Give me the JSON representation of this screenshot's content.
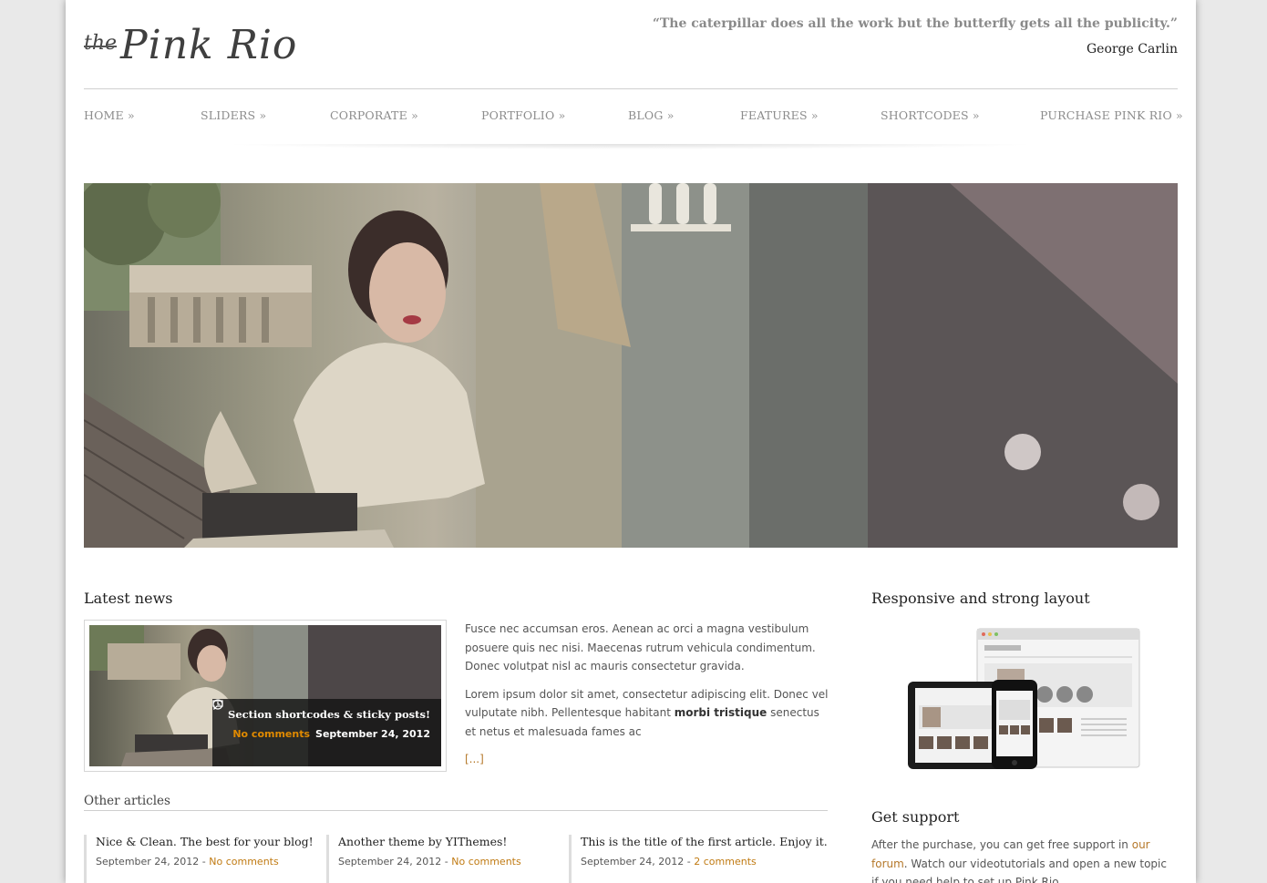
{
  "header": {
    "logo_the": "the",
    "logo_main": "Pink Rio",
    "quote": "“The caterpillar does all the work but the butterfly gets all the publicity.”",
    "quote_author": "George Carlin"
  },
  "nav": {
    "items": [
      {
        "label": "HOME »"
      },
      {
        "label": "SLIDERS »"
      },
      {
        "label": "CORPORATE »"
      },
      {
        "label": "PORTFOLIO »"
      },
      {
        "label": "BLOG »"
      },
      {
        "label": "FEATURES »"
      },
      {
        "label": "SHORTCODES »"
      },
      {
        "label": "PURCHASE PINK RIO »"
      }
    ]
  },
  "latest_news": {
    "heading": "Latest news",
    "caption_title": "Section shortcodes & sticky posts!",
    "caption_comments": "No comments",
    "caption_date": "September 24, 2012",
    "paragraph1": "Fusce nec accumsan eros. Aenean ac orci a magna vestibulum posuere quis nec nisi. Maecenas rutrum vehicula condimentum. Donec volutpat nisl ac mauris consectetur gravida.",
    "paragraph2_before": "Lorem ipsum dolor sit amet, consectetur adipiscing elit. Donec vel vulputate nibh. Pellentesque habitant ",
    "paragraph2_bold": "morbi tristique",
    "paragraph2_after": " senectus et netus et malesuada fames ac",
    "more": "[...]"
  },
  "other_articles": {
    "heading": "Other articles",
    "items": [
      {
        "title": "Nice & Clean. The best for your blog!",
        "date": "September 24, 2012",
        "sep": " - ",
        "comments": "No comments"
      },
      {
        "title": "Another theme by YIThemes!",
        "date": "September 24, 2012",
        "sep": " - ",
        "comments": "No comments"
      },
      {
        "title": "This is the title of the first article. Enjoy it.",
        "date": "September 24, 2012",
        "sep": " - ",
        "comments": "2 comments"
      }
    ]
  },
  "sidebar": {
    "layout_heading": "Responsive and strong layout",
    "support_heading": "Get support",
    "support_before": "After the purchase, you can get free support in ",
    "support_link": "our forum",
    "support_after": ". Watch our videotutorials and open a new topic if you need help to set up Pink Rio."
  },
  "colors": {
    "accent": "#c07a12",
    "nav_text": "#8c8c8c"
  }
}
